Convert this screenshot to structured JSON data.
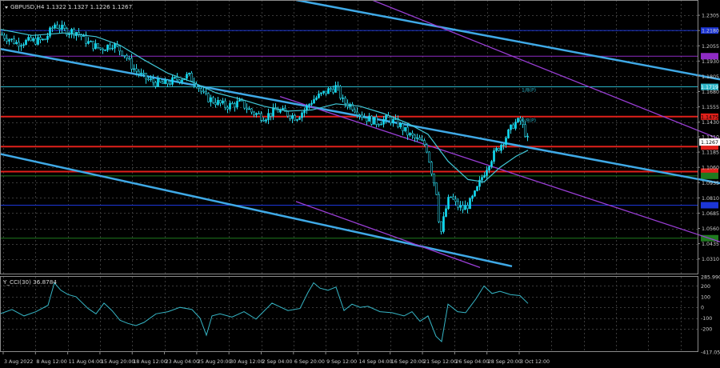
{
  "main_title": "GBPUSD,H4  1.1322 1.1327 1.1226 1.1267",
  "indicator_title": "Y_CCI(30) 36.8784",
  "colors": {
    "background": "#000000",
    "grid": "#3a3a3a",
    "frame": "#8a8a8a",
    "bull_candle": "#00e5ff",
    "bear_candle": "#000000",
    "candle_line": "#2ad3e6",
    "ma": "#40c8d8",
    "channel_blue": "#3fa9e6",
    "channel_purple": "#9a3ed6",
    "murray_red": "#e0201a",
    "murray_blue": "#1c36d6",
    "murray_purple": "#8e2bc4",
    "murray_green": "#1f7a1f",
    "murray_cyan": "#2ab5c8",
    "cci": "#36b6c6"
  },
  "chart_data": [
    {
      "type": "candlestick",
      "symbol": "GBPUSD",
      "timeframe": "H4",
      "ohlc_header": {
        "open": 1.1322,
        "high": 1.1327,
        "low": 1.1226,
        "close": 1.1267
      },
      "ylim": [
        1.019,
        1.243
      ],
      "y_ticks": [
        1.2305,
        1.218,
        1.2055,
        1.193,
        1.1805,
        1.168,
        1.1555,
        1.143,
        1.131,
        1.1185,
        1.106,
        1.0935,
        1.081,
        1.0685,
        1.056,
        1.0435,
        1.031
      ],
      "x_ticks": [
        "3 Aug 2022",
        "8 Aug 12:00",
        "11 Aug 04:00",
        "15 Aug 20:00",
        "18 Aug 12:00",
        "23 Aug 04:00",
        "25 Aug 20:00",
        "30 Aug 12:00",
        "2 Sep 04:00",
        "6 Sep 20:00",
        "9 Sep 12:00",
        "14 Sep 04:00",
        "16 Sep 20:00",
        "21 Sep 12:00",
        "26 Sep 04:00",
        "28 Sep 20:00",
        "3 Oct 12:00"
      ],
      "grid": true,
      "close_path": [
        [
          0,
          1.215
        ],
        [
          20,
          1.208
        ],
        [
          40,
          1.2095
        ],
        [
          55,
          1.21
        ],
        [
          68,
          1.223
        ],
        [
          80,
          1.218
        ],
        [
          95,
          1.217
        ],
        [
          110,
          1.208
        ],
        [
          125,
          1.203
        ],
        [
          140,
          1.207
        ],
        [
          155,
          1.199
        ],
        [
          165,
          1.188
        ],
        [
          178,
          1.18
        ],
        [
          190,
          1.176
        ],
        [
          205,
          1.174
        ],
        [
          220,
          1.178
        ],
        [
          235,
          1.181
        ],
        [
          245,
          1.175
        ],
        [
          255,
          1.164
        ],
        [
          268,
          1.16
        ],
        [
          282,
          1.156
        ],
        [
          300,
          1.159
        ],
        [
          315,
          1.151
        ],
        [
          330,
          1.147
        ],
        [
          345,
          1.153
        ],
        [
          358,
          1.15
        ],
        [
          370,
          1.147
        ],
        [
          380,
          1.153
        ],
        [
          390,
          1.161
        ],
        [
          400,
          1.165
        ],
        [
          410,
          1.169
        ],
        [
          420,
          1.172
        ],
        [
          428,
          1.16
        ],
        [
          440,
          1.156
        ],
        [
          455,
          1.147
        ],
        [
          470,
          1.143
        ],
        [
          485,
          1.146
        ],
        [
          498,
          1.141
        ],
        [
          510,
          1.133
        ],
        [
          522,
          1.128
        ],
        [
          532,
          1.124
        ],
        [
          540,
          1.1
        ],
        [
          545,
          1.086
        ],
        [
          550,
          1.05
        ],
        [
          556,
          1.07
        ],
        [
          562,
          1.083
        ],
        [
          570,
          1.075
        ],
        [
          578,
          1.072
        ],
        [
          586,
          1.076
        ],
        [
          594,
          1.085
        ],
        [
          602,
          1.098
        ],
        [
          610,
          1.109
        ],
        [
          618,
          1.118
        ],
        [
          626,
          1.125
        ],
        [
          634,
          1.133
        ],
        [
          642,
          1.142
        ],
        [
          650,
          1.144
        ],
        [
          655,
          1.136
        ],
        [
          660,
          1.1267
        ]
      ],
      "moving_average": [
        [
          0,
          1.219
        ],
        [
          40,
          1.214
        ],
        [
          80,
          1.216
        ],
        [
          120,
          1.213
        ],
        [
          150,
          1.206
        ],
        [
          180,
          1.194
        ],
        [
          210,
          1.183
        ],
        [
          240,
          1.176
        ],
        [
          270,
          1.167
        ],
        [
          300,
          1.162
        ],
        [
          330,
          1.156
        ],
        [
          360,
          1.152
        ],
        [
          390,
          1.153
        ],
        [
          420,
          1.158
        ],
        [
          450,
          1.156
        ],
        [
          480,
          1.15
        ],
        [
          510,
          1.142
        ],
        [
          535,
          1.133
        ],
        [
          560,
          1.111
        ],
        [
          585,
          1.096
        ],
        [
          605,
          1.094
        ],
        [
          625,
          1.106
        ],
        [
          645,
          1.115
        ],
        [
          660,
          1.12
        ]
      ],
      "trend_channels": {
        "blue": [
          {
            "p1": [
              0,
              1.203
            ],
            "p2": [
              900,
              1.093
            ]
          },
          {
            "p1": [
              0,
              1.117
            ],
            "p2": [
              640,
              1.025
            ]
          },
          {
            "p1": [
              370,
              1.243
            ],
            "p2": [
              900,
              1.178
            ]
          }
        ],
        "purple": [
          {
            "p1": [
              465,
              1.243
            ],
            "p2": [
              900,
              1.129
            ]
          },
          {
            "p1": [
              350,
              1.164
            ],
            "p2": [
              900,
              1.045
            ]
          },
          {
            "p1": [
              370,
              1.078
            ],
            "p2": [
              600,
              1.024
            ]
          }
        ]
      },
      "murray_levels": [
        {
          "price": 1.218,
          "color": "murray_blue",
          "label": ""
        },
        {
          "price": 1.197,
          "color": "murray_purple",
          "label": ""
        },
        {
          "price": 1.1719,
          "color": "murray_cyan",
          "label": "1.1719"
        },
        {
          "price": 1.1475,
          "color": "murray_red",
          "label": "1.1475"
        },
        {
          "price": 1.123,
          "color": "murray_red",
          "label": ""
        },
        {
          "price": 1.1025,
          "color": "murray_red",
          "label": ""
        },
        {
          "price": 1.099,
          "color": "murray_green",
          "label": ""
        },
        {
          "price": 1.075,
          "color": "murray_blue",
          "label": ""
        },
        {
          "price": 1.048,
          "color": "murray_green",
          "label": ""
        }
      ],
      "level_tags": [
        {
          "text": "1/8(P)",
          "price": 1.168,
          "x": 652
        },
        {
          "text": "0/8(P)",
          "price": 1.143,
          "x": 652
        }
      ],
      "current_price_label": "1.1267",
      "top_price_label": "1.2305",
      "price_labels": [
        "1.2305",
        "1.2180",
        "1.2055",
        "1.1930",
        "1.1805",
        "1.1680",
        "1.1555",
        "1.1430",
        "1.1310",
        "1.1185",
        "1.1060",
        "1.0935",
        "1.0810",
        "1.0685",
        "1.0560",
        "1.0435",
        "1.0310"
      ]
    },
    {
      "type": "line",
      "indicator": "Y_CCI(30)",
      "value": 36.8784,
      "ylim": [
        -417.0564,
        285.9903
      ],
      "y_ticks": [
        285.9903,
        200,
        100,
        0,
        -100,
        -200,
        -417.0564
      ],
      "y_tick_labels": [
        "285.9903",
        "200",
        "100",
        "0",
        "-100",
        "-200",
        "-417.0564"
      ],
      "grid": true,
      "series_path": [
        [
          0,
          -60
        ],
        [
          15,
          -20
        ],
        [
          30,
          -80
        ],
        [
          45,
          -40
        ],
        [
          60,
          20
        ],
        [
          68,
          230
        ],
        [
          76,
          160
        ],
        [
          85,
          120
        ],
        [
          95,
          100
        ],
        [
          110,
          -10
        ],
        [
          120,
          -60
        ],
        [
          130,
          40
        ],
        [
          140,
          -30
        ],
        [
          150,
          -120
        ],
        [
          160,
          -150
        ],
        [
          170,
          -170
        ],
        [
          180,
          -140
        ],
        [
          195,
          -60
        ],
        [
          210,
          -40
        ],
        [
          225,
          0
        ],
        [
          240,
          -20
        ],
        [
          250,
          -100
        ],
        [
          258,
          -260
        ],
        [
          265,
          -80
        ],
        [
          275,
          -60
        ],
        [
          290,
          -90
        ],
        [
          305,
          -40
        ],
        [
          320,
          -110
        ],
        [
          340,
          40
        ],
        [
          360,
          -30
        ],
        [
          375,
          -10
        ],
        [
          385,
          140
        ],
        [
          392,
          230
        ],
        [
          400,
          180
        ],
        [
          410,
          160
        ],
        [
          420,
          190
        ],
        [
          430,
          -30
        ],
        [
          440,
          30
        ],
        [
          450,
          0
        ],
        [
          460,
          10
        ],
        [
          475,
          -40
        ],
        [
          490,
          -50
        ],
        [
          505,
          -80
        ],
        [
          515,
          -40
        ],
        [
          525,
          -130
        ],
        [
          535,
          -80
        ],
        [
          545,
          -270
        ],
        [
          552,
          -320
        ],
        [
          560,
          30
        ],
        [
          572,
          -40
        ],
        [
          582,
          -50
        ],
        [
          595,
          80
        ],
        [
          605,
          200
        ],
        [
          615,
          130
        ],
        [
          625,
          150
        ],
        [
          638,
          120
        ],
        [
          650,
          110
        ],
        [
          660,
          37
        ]
      ]
    }
  ]
}
